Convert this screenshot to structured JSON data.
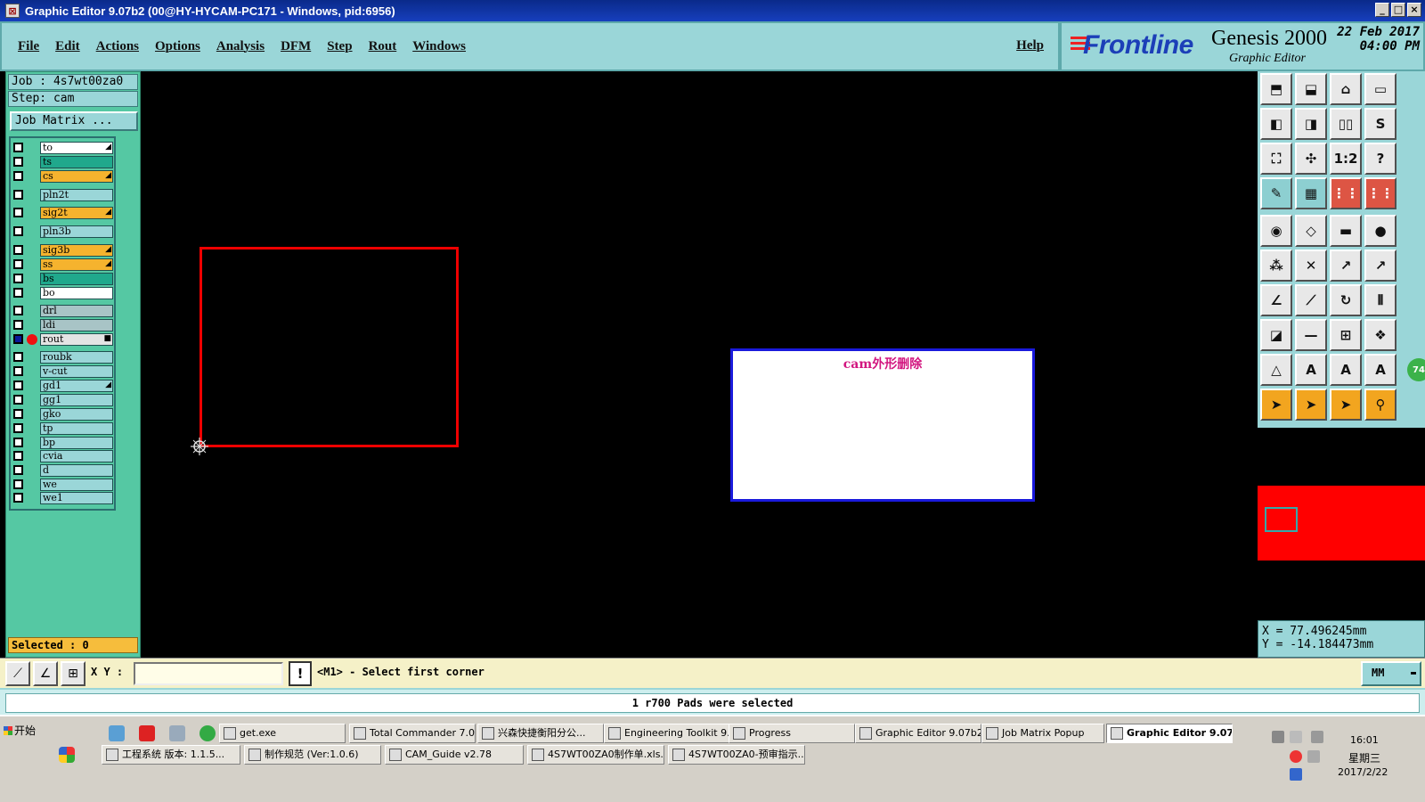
{
  "window": {
    "title": "Graphic Editor 9.07b2 (00@HY-HYCAM-PC171 - Windows, pid:6956)"
  },
  "menu": {
    "items": [
      "File",
      "Edit",
      "Actions",
      "Options",
      "Analysis",
      "DFM",
      "Step",
      "Rout",
      "Windows"
    ],
    "help": "Help"
  },
  "branding": {
    "logo": "Frontline",
    "product": "Genesis 2000",
    "subtitle": "Graphic Editor",
    "date": "22 Feb 2017",
    "time": "04:00 PM"
  },
  "job": {
    "job_label": "Job  : 4s7wt00za0",
    "step_label": "Step: cam",
    "job_matrix_button": "Job Matrix ..."
  },
  "layers": [
    {
      "name": "to",
      "color": "#ffffff",
      "mark": "◢"
    },
    {
      "name": "ts",
      "color": "#20a88c",
      "mark": ""
    },
    {
      "name": "cs",
      "color": "#f5b32e",
      "mark": "◢"
    },
    {
      "name": "pln2t",
      "color": "#9ad6d8",
      "mark": ""
    },
    {
      "name": "sig2t",
      "color": "#f5b32e",
      "mark": "◢"
    },
    {
      "name": "pln3b",
      "color": "#9ad6d8",
      "mark": ""
    },
    {
      "name": "sig3b",
      "color": "#f5b32e",
      "mark": "◢"
    },
    {
      "name": "ss",
      "color": "#f5b32e",
      "mark": "◢"
    },
    {
      "name": "bs",
      "color": "#20a88c",
      "mark": ""
    },
    {
      "name": "bo",
      "color": "#ffffff",
      "mark": ""
    },
    {
      "name": "drl",
      "color": "#a8c4c6",
      "mark": ""
    },
    {
      "name": "ldi",
      "color": "#a8c4c6",
      "mark": ""
    },
    {
      "name": "rout",
      "color": "#e4e4e4",
      "mark": "■"
    },
    {
      "name": "roubk",
      "color": "#9ad6d8",
      "mark": ""
    },
    {
      "name": "v-cut",
      "color": "#9ad6d8",
      "mark": ""
    },
    {
      "name": "gd1",
      "color": "#9ad6d8",
      "mark": "◢"
    },
    {
      "name": "gg1",
      "color": "#9ad6d8",
      "mark": ""
    },
    {
      "name": "gko",
      "color": "#9ad6d8",
      "mark": ""
    },
    {
      "name": "tp",
      "color": "#9ad6d8",
      "mark": ""
    },
    {
      "name": "bp",
      "color": "#9ad6d8",
      "mark": ""
    },
    {
      "name": "cvia",
      "color": "#9ad6d8",
      "mark": ""
    },
    {
      "name": "d",
      "color": "#9ad6d8",
      "mark": ""
    },
    {
      "name": "we",
      "color": "#9ad6d8",
      "mark": ""
    },
    {
      "name": "we1",
      "color": "#9ad6d8",
      "mark": ""
    }
  ],
  "selected": "Selected : 0",
  "canvas": {
    "note_text": "cam外形删除"
  },
  "toolbar": {
    "labels": [
      "1:2",
      "?"
    ],
    "badge": "74"
  },
  "coords": {
    "x": "X  =  77.496245mm",
    "y": "Y  = -14.184473mm"
  },
  "command": {
    "xy_label": "X Y :",
    "xy_value": "",
    "warn": "!",
    "prompt": "<M1> - Select first corner",
    "units": "MM"
  },
  "status": {
    "message": "1 r700 Pads were selected"
  },
  "taskbar": {
    "start": "开始",
    "row1": [
      {
        "label": "get.exe"
      },
      {
        "label": "Total Commander 7.0..."
      },
      {
        "label": "兴森快捷衡阳分公..."
      },
      {
        "label": "Engineering Toolkit 9...."
      },
      {
        "label": "Progress"
      },
      {
        "label": "Graphic Editor 9.07b2..."
      },
      {
        "label": "Job Matrix Popup"
      },
      {
        "label": "Graphic Editor 9.07..."
      }
    ],
    "row2": [
      {
        "label": "工程系统  版本: 1.1.5..."
      },
      {
        "label": "制作规范 (Ver:1.0.6)"
      },
      {
        "label": "CAM_Guide v2.78"
      },
      {
        "label": "4S7WT00ZA0制作单.xls..."
      },
      {
        "label": "4S7WT00ZA0-预审指示..."
      }
    ],
    "time": "16:01",
    "day": "星期三",
    "date": "2017/2/22"
  }
}
